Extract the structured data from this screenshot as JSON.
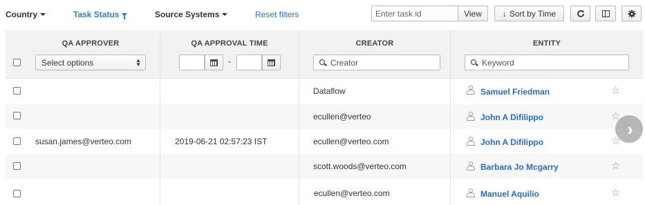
{
  "toolbar": {
    "filters": [
      {
        "label": "Country"
      },
      {
        "label": "Task Status"
      },
      {
        "label": "Source Systems"
      }
    ],
    "reset_label": "Reset filters",
    "task_input_placeholder": "Enter task id",
    "view_label": "View",
    "sort_label": "Sort by Time",
    "accent_color": "#2a84b7",
    "link_color": "#2a6cc4"
  },
  "table": {
    "headers": {
      "qa_approver": "QA APPROVER",
      "qa_approval_time": "QA APPROVAL TIME",
      "creator": "CREATOR",
      "entity": "ENTITY"
    },
    "filters": {
      "qa_approver_select": "Select options",
      "date_separator": "-",
      "creator_placeholder": "Creator",
      "entity_placeholder": "Keyword"
    },
    "rows": [
      {
        "qa_approver": "",
        "qa_approval_time": "",
        "creator": "Dataflow",
        "entity": "Samuel Friedman"
      },
      {
        "qa_approver": "",
        "qa_approval_time": "",
        "creator": "ecullen@verteo",
        "entity": "John A Difilippo"
      },
      {
        "qa_approver": "susan.james@verteo.com",
        "qa_approval_time": "2019-06-21 02:57:23 IST",
        "creator": "ecullen@verteo.com",
        "entity": "John A Difilippo"
      },
      {
        "qa_approver": "",
        "qa_approval_time": "",
        "creator": "scott.woods@verteo.com",
        "entity": "Barbara Jo Mcgarry"
      },
      {
        "qa_approver": "",
        "qa_approval_time": "",
        "creator": "ecullen@verteo.com",
        "entity": "Manuel Aquilio"
      }
    ]
  }
}
